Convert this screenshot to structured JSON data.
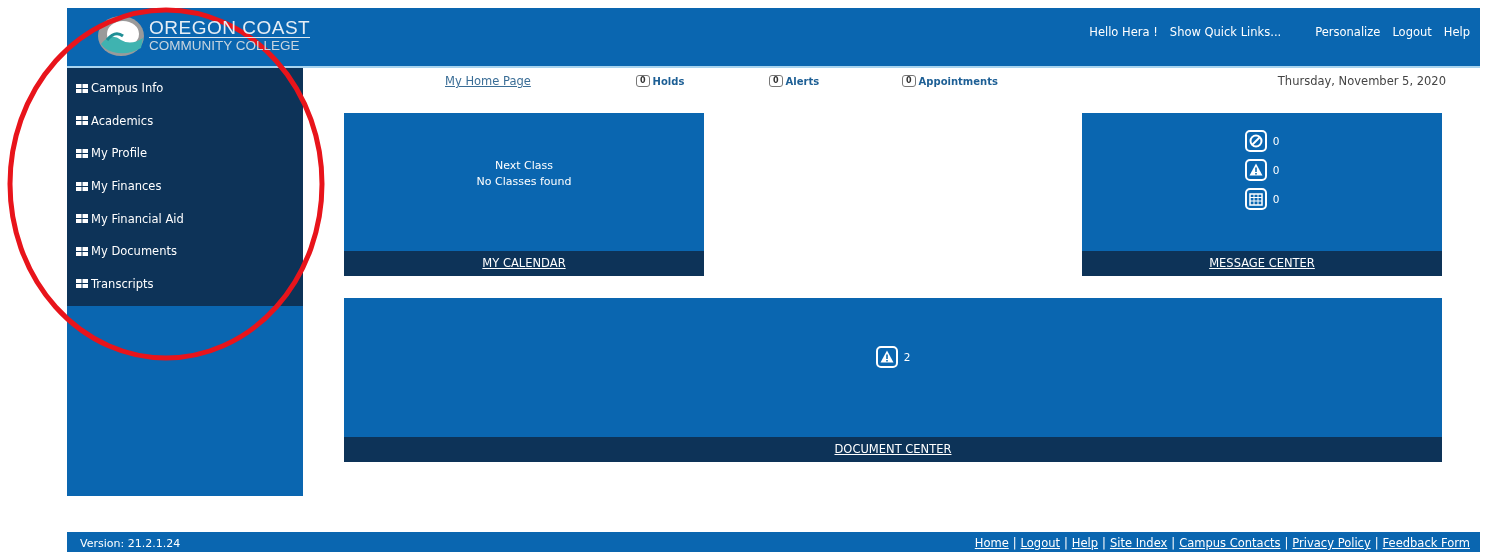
{
  "header": {
    "logo": {
      "line1": "OREGON COAST",
      "line2": "COMMUNITY COLLEGE"
    },
    "greeting": "Hello Hera !",
    "links": [
      "Show Quick Links...",
      "Personalize",
      "Logout",
      "Help"
    ]
  },
  "sidebar": {
    "items": [
      {
        "label": "Campus Info"
      },
      {
        "label": "Academics"
      },
      {
        "label": "My Profile"
      },
      {
        "label": "My Finances"
      },
      {
        "label": "My Financial Aid"
      },
      {
        "label": "My Documents"
      },
      {
        "label": "Transcripts"
      }
    ]
  },
  "topbar": {
    "home_link": "My Home Page",
    "counters": [
      {
        "count": "0",
        "label": "Holds"
      },
      {
        "count": "0",
        "label": "Alerts"
      },
      {
        "count": "0",
        "label": "Appointments"
      }
    ],
    "date": "Thursday, November 5, 2020"
  },
  "calendar_card": {
    "heading": "Next Class",
    "text": "No Classes found",
    "footer": "MY CALENDAR"
  },
  "message_center": {
    "items": [
      {
        "kind": "block",
        "count": "0"
      },
      {
        "kind": "warning",
        "count": "0"
      },
      {
        "kind": "calendar",
        "count": "0"
      }
    ],
    "footer": "MESSAGE CENTER"
  },
  "document_center": {
    "items": [
      {
        "kind": "warning",
        "count": "2"
      }
    ],
    "footer": "DOCUMENT CENTER"
  },
  "footer": {
    "version": "Version: 21.2.1.24",
    "separator": "|",
    "links": [
      "Home",
      "Logout",
      "Help",
      "Site Index",
      "Campus Contacts",
      "Privacy Policy",
      "Feedback Form"
    ]
  },
  "annotation": {
    "kind": "circle",
    "color": "#e8141b"
  }
}
